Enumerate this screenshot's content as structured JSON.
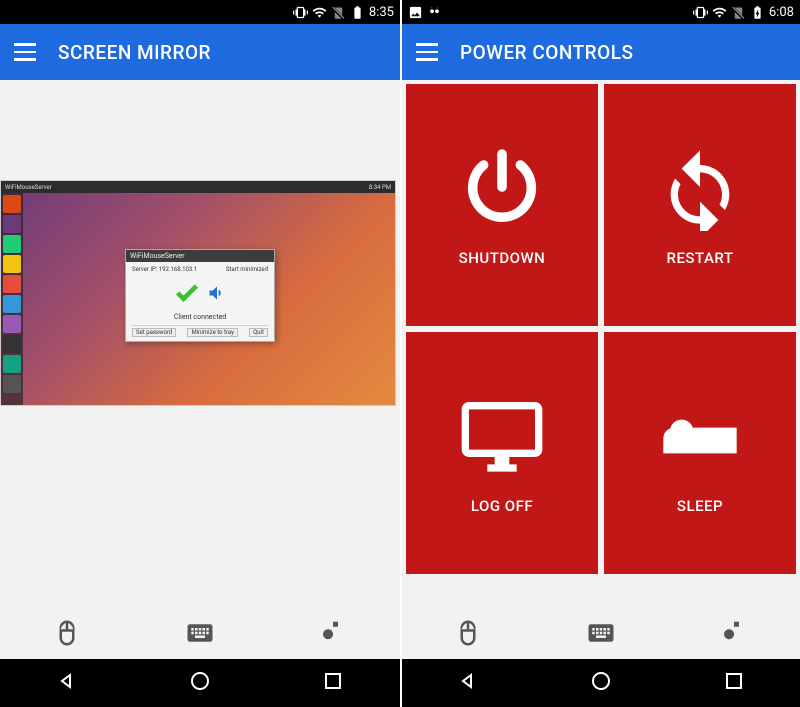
{
  "left": {
    "status": {
      "time": "8:35"
    },
    "title": "SCREEN MIRROR",
    "mirror": {
      "top_bar_left": "WiFiMouseServer",
      "top_bar_right": "8:34 PM",
      "dialog_title": "WiFiMouseServer",
      "server_ip_label": "Server IP: 192.168.103.1",
      "start_min_label": "Start minimized",
      "status_text": "Client connected",
      "btn_set_password": "Set password",
      "btn_minimize": "Minimize to tray",
      "btn_quit": "Quit"
    }
  },
  "right": {
    "status": {
      "time": "6:08"
    },
    "title": "POWER CONTROLS",
    "tiles": {
      "shutdown": "SHUTDOWN",
      "restart": "RESTART",
      "logoff": "LOG OFF",
      "sleep": "SLEEP"
    }
  }
}
